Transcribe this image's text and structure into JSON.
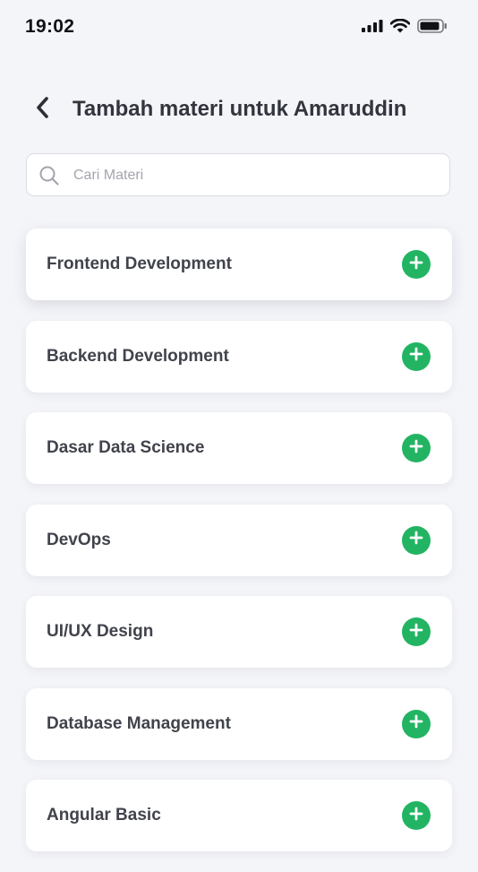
{
  "status_bar": {
    "time": "19:02",
    "icons": [
      "cellular-signal-icon",
      "wifi-icon",
      "battery-icon"
    ]
  },
  "header": {
    "back_icon": "chevron-left-icon",
    "title": "Tambah materi untuk Amaruddin"
  },
  "search": {
    "icon": "search-icon",
    "value": "",
    "placeholder": "Cari Materi"
  },
  "materials": [
    {
      "label": "Frontend Development"
    },
    {
      "label": "Backend Development"
    },
    {
      "label": "Dasar Data Science"
    },
    {
      "label": "DevOps"
    },
    {
      "label": "UI/UX Design"
    },
    {
      "label": "Database Management"
    },
    {
      "label": "Angular Basic"
    }
  ],
  "add_icon": "plus-icon",
  "colors": {
    "background": "#F4F5F9",
    "card": "#FFFFFF",
    "accent_green": "#22B463",
    "title_text": "#33353E",
    "placeholder_text": "#A3A5AD"
  }
}
